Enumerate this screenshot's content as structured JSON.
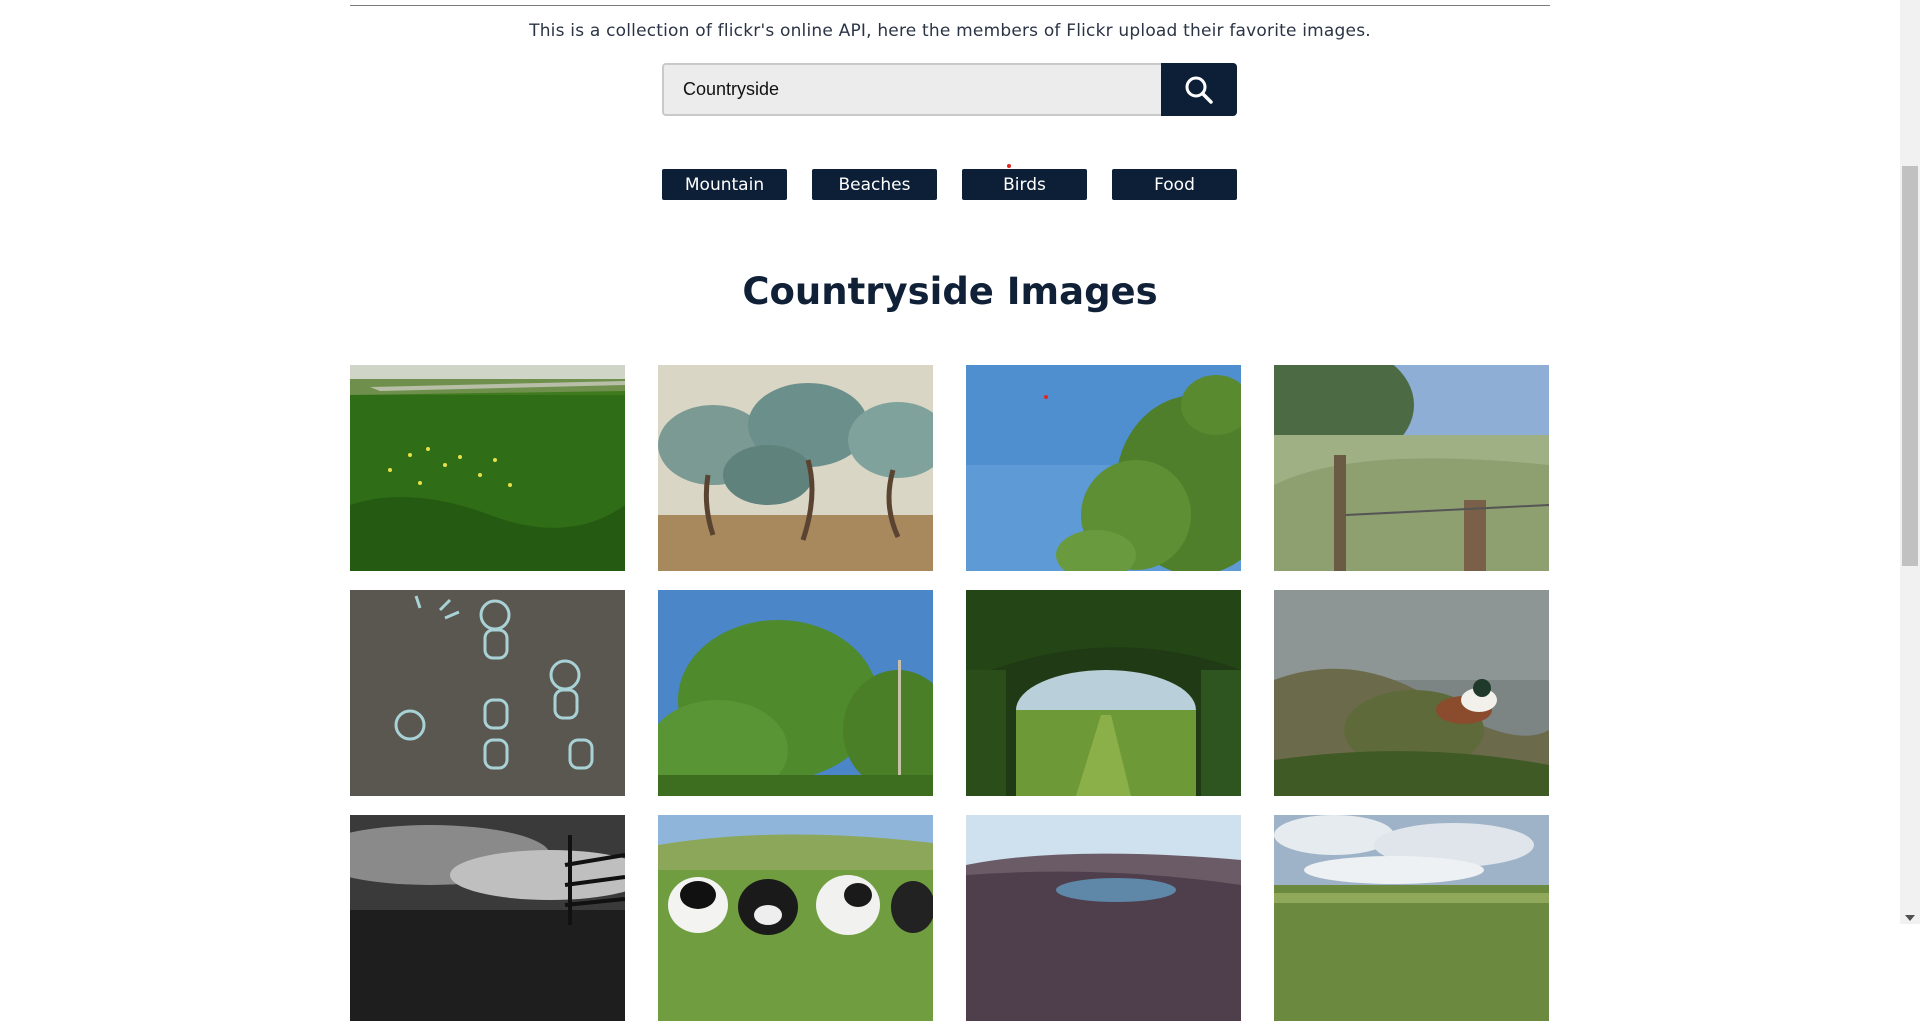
{
  "description": "This is a collection of flickr's online API, here the members of Flickr upload their favorite images.",
  "search": {
    "value": "Countryside",
    "button_icon": "search-icon"
  },
  "categories": [
    "Mountain",
    "Beaches",
    "Birds",
    "Food"
  ],
  "heading": "Countryside Images",
  "colors": {
    "accent": "#0d1f36",
    "heading": "#0f2037",
    "input_bg": "#ececec"
  },
  "images": [
    {
      "subject": "grass-field"
    },
    {
      "subject": "olive-trees-painting"
    },
    {
      "subject": "tree-against-sky"
    },
    {
      "subject": "fence-post-grass"
    },
    {
      "subject": "chalk-drawings-pavement"
    },
    {
      "subject": "green-trees-sky"
    },
    {
      "subject": "field-through-trees"
    },
    {
      "subject": "duck-in-reeds"
    },
    {
      "subject": "gate-under-clouds"
    },
    {
      "subject": "cows-in-pasture"
    },
    {
      "subject": "lake-in-hills"
    },
    {
      "subject": "cloudy-farmland"
    }
  ]
}
